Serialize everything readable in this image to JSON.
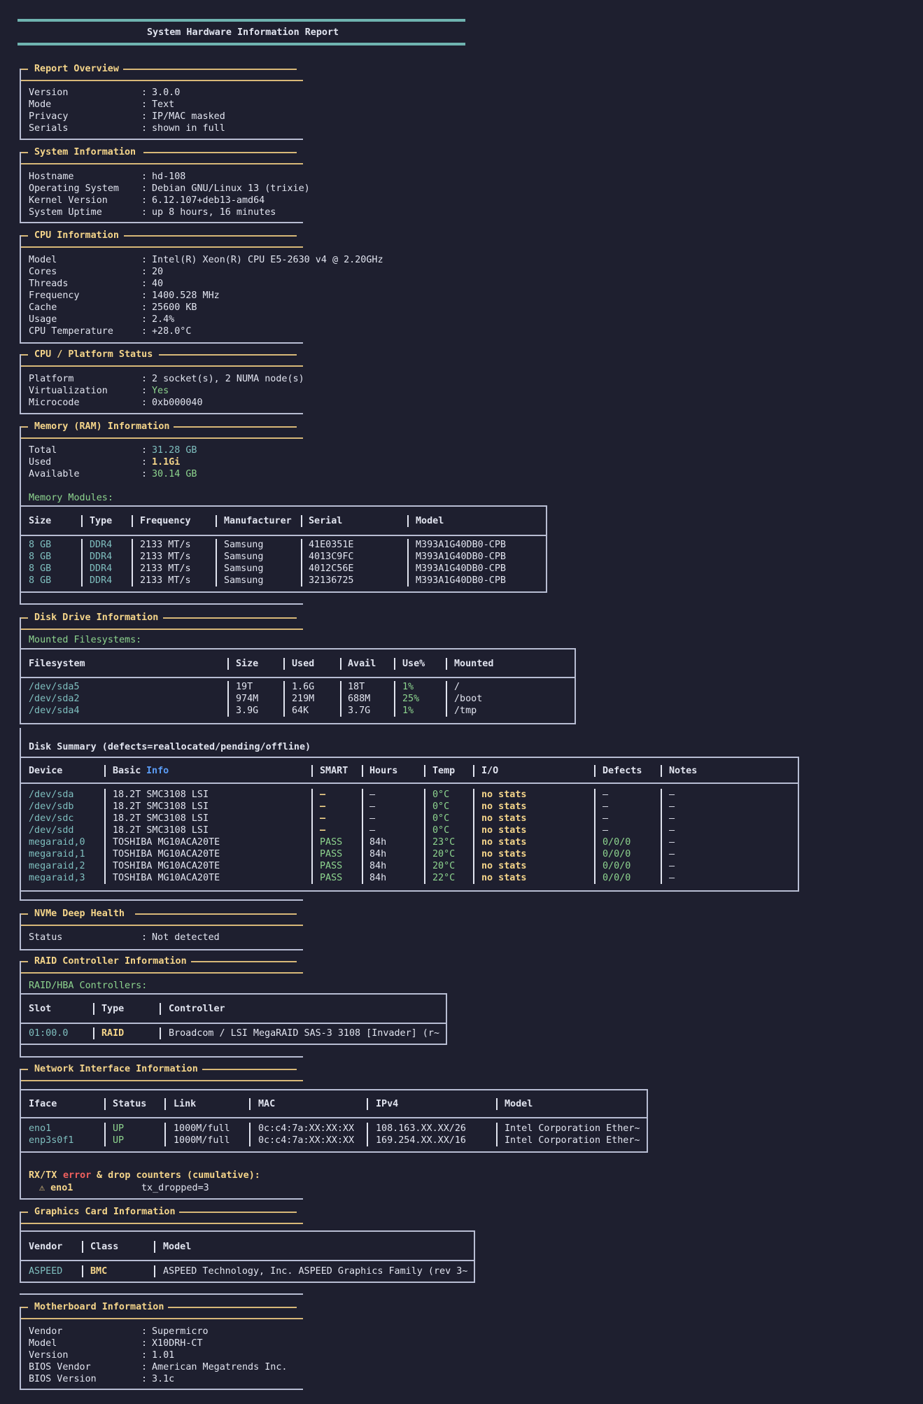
{
  "report_title": "System Hardware Information Report",
  "overview": {
    "title": "Report Overview",
    "rows": [
      {
        "k": "Version",
        "v": "3.0.0"
      },
      {
        "k": "Mode",
        "v": "Text"
      },
      {
        "k": "Privacy",
        "v": "IP/MAC masked"
      },
      {
        "k": "Serials",
        "v": "shown in full"
      }
    ]
  },
  "system": {
    "title": "System Information",
    "rows": [
      {
        "k": "Hostname",
        "v": "hd-108"
      },
      {
        "k": "Operating System",
        "v": "Debian GNU/Linux 13 (trixie)"
      },
      {
        "k": "Kernel Version",
        "v": "6.12.107+deb13-amd64"
      },
      {
        "k": "System Uptime",
        "v": "up 8 hours, 16 minutes"
      }
    ]
  },
  "cpu": {
    "title": "CPU Information",
    "rows": [
      {
        "k": "Model",
        "v": "Intel(R) Xeon(R) CPU E5-2630 v4 @ 2.20GHz"
      },
      {
        "k": "Cores",
        "v": "20"
      },
      {
        "k": "Threads",
        "v": "40"
      },
      {
        "k": "Frequency",
        "v": "1400.528 MHz"
      },
      {
        "k": "Cache",
        "v": "25600 KB"
      },
      {
        "k": "Usage",
        "v": "2.4%"
      },
      {
        "k": "CPU Temperature",
        "v": "+28.0°C"
      }
    ]
  },
  "platform": {
    "title": "CPU / Platform Status",
    "rows": [
      {
        "k": "Platform",
        "v": "2 socket(s), 2 NUMA node(s)"
      },
      {
        "k": "Virtualization",
        "v": "Yes"
      },
      {
        "k": "Microcode",
        "v": "0xb000040"
      }
    ]
  },
  "memory": {
    "title": "Memory (RAM) Information",
    "total_label": "Total",
    "total": "31.28 GB",
    "used_label": "Used",
    "used": "1.1Gi",
    "avail_label": "Available",
    "avail": "30.14 GB",
    "modules_label": "Memory Modules:",
    "headers": [
      "Size",
      "Type",
      "Frequency",
      "Manufacturer",
      "Serial",
      "Model"
    ],
    "rows": [
      [
        "8 GB",
        "DDR4",
        "2133 MT/s",
        "Samsung",
        "41E0351E",
        "M393A1G40DB0-CPB"
      ],
      [
        "8 GB",
        "DDR4",
        "2133 MT/s",
        "Samsung",
        "4013C9FC",
        "M393A1G40DB0-CPB"
      ],
      [
        "8 GB",
        "DDR4",
        "2133 MT/s",
        "Samsung",
        "4012C56E",
        "M393A1G40DB0-CPB"
      ],
      [
        "8 GB",
        "DDR4",
        "2133 MT/s",
        "Samsung",
        "32136725",
        "M393A1G40DB0-CPB"
      ]
    ]
  },
  "disk": {
    "title": "Disk Drive Information",
    "fs_label": "Mounted Filesystems:",
    "fs_headers": [
      "Filesystem",
      "Size",
      "Used",
      "Avail",
      "Use%",
      "Mounted"
    ],
    "fs_rows": [
      [
        "/dev/sda5",
        "19T",
        "1.6G",
        "18T",
        "1%",
        "/"
      ],
      [
        "/dev/sda2",
        "974M",
        "219M",
        "688M",
        "25%",
        "/boot"
      ],
      [
        "/dev/sda4",
        "3.9G",
        "64K",
        "3.7G",
        "1%",
        "/tmp"
      ]
    ],
    "summary_label": "Disk Summary (defects=reallocated/pending/offline)",
    "sum_headers": [
      "Device",
      "Basic ",
      "Info",
      "SMART",
      "Hours",
      "Temp",
      "I/O",
      "Defects",
      "Notes"
    ],
    "sum_rows": [
      [
        "/dev/sda",
        "18.2T SMC3108 LSI",
        "–",
        "–",
        "0°C",
        "no stats",
        "–",
        "–"
      ],
      [
        "/dev/sdb",
        "18.2T SMC3108 LSI",
        "–",
        "–",
        "0°C",
        "no stats",
        "–",
        "–"
      ],
      [
        "/dev/sdc",
        "18.2T SMC3108 LSI",
        "–",
        "–",
        "0°C",
        "no stats",
        "–",
        "–"
      ],
      [
        "/dev/sdd",
        "18.2T SMC3108 LSI",
        "–",
        "–",
        "0°C",
        "no stats",
        "–",
        "–"
      ],
      [
        "megaraid,0",
        "TOSHIBA MG10ACA20TE",
        "PASS",
        "84h",
        "23°C",
        "no stats",
        "0/0/0",
        "–"
      ],
      [
        "megaraid,1",
        "TOSHIBA MG10ACA20TE",
        "PASS",
        "84h",
        "20°C",
        "no stats",
        "0/0/0",
        "–"
      ],
      [
        "megaraid,2",
        "TOSHIBA MG10ACA20TE",
        "PASS",
        "84h",
        "20°C",
        "no stats",
        "0/0/0",
        "–"
      ],
      [
        "megaraid,3",
        "TOSHIBA MG10ACA20TE",
        "PASS",
        "84h",
        "22°C",
        "no stats",
        "0/0/0",
        "–"
      ]
    ]
  },
  "nvme": {
    "title": "NVMe Deep Health",
    "k": "Status",
    "v": "Not detected"
  },
  "raid": {
    "title": "RAID Controller Information",
    "label": "RAID/HBA Controllers:",
    "headers": [
      "Slot",
      "Type",
      "Controller"
    ],
    "row": [
      "01:00.0",
      "RAID",
      "Broadcom / LSI MegaRAID SAS-3 3108 [Invader] (r~"
    ]
  },
  "network": {
    "title": "Network Interface Information",
    "headers": [
      "Iface",
      "Status",
      "Link",
      "MAC",
      "IPv4",
      "Model"
    ],
    "rows": [
      [
        "eno1",
        "UP",
        "1000M/full",
        "0c:c4:7a:XX:XX:XX",
        "108.163.XX.XX/26",
        "Intel Corporation Ether~"
      ],
      [
        "enp3s0f1",
        "UP",
        "1000M/full",
        "0c:c4:7a:XX:XX:XX",
        "169.254.XX.XX/16",
        "Intel Corporation Ether~"
      ]
    ],
    "err_a": "RX/TX ",
    "err_b": "error",
    "err_c": " & drop counters (cumulative):",
    "warn_iface": "⚠ eno1",
    "warn_val": "tx_dropped=3"
  },
  "gpu": {
    "title": "Graphics Card Information",
    "headers": [
      "Vendor",
      "Class",
      "Model"
    ],
    "row": [
      "ASPEED",
      "BMC",
      "ASPEED Technology, Inc. ASPEED Graphics Family (rev 3~"
    ]
  },
  "mobo": {
    "title": "Motherboard Information",
    "rows": [
      {
        "k": "Vendor",
        "v": "Supermicro"
      },
      {
        "k": "Model",
        "v": "X10DRH-CT"
      },
      {
        "k": "Version",
        "v": "1.01"
      },
      {
        "k": "BIOS Vendor",
        "v": "American Megatrends Inc."
      },
      {
        "k": "BIOS Version",
        "v": "3.1c"
      }
    ]
  }
}
